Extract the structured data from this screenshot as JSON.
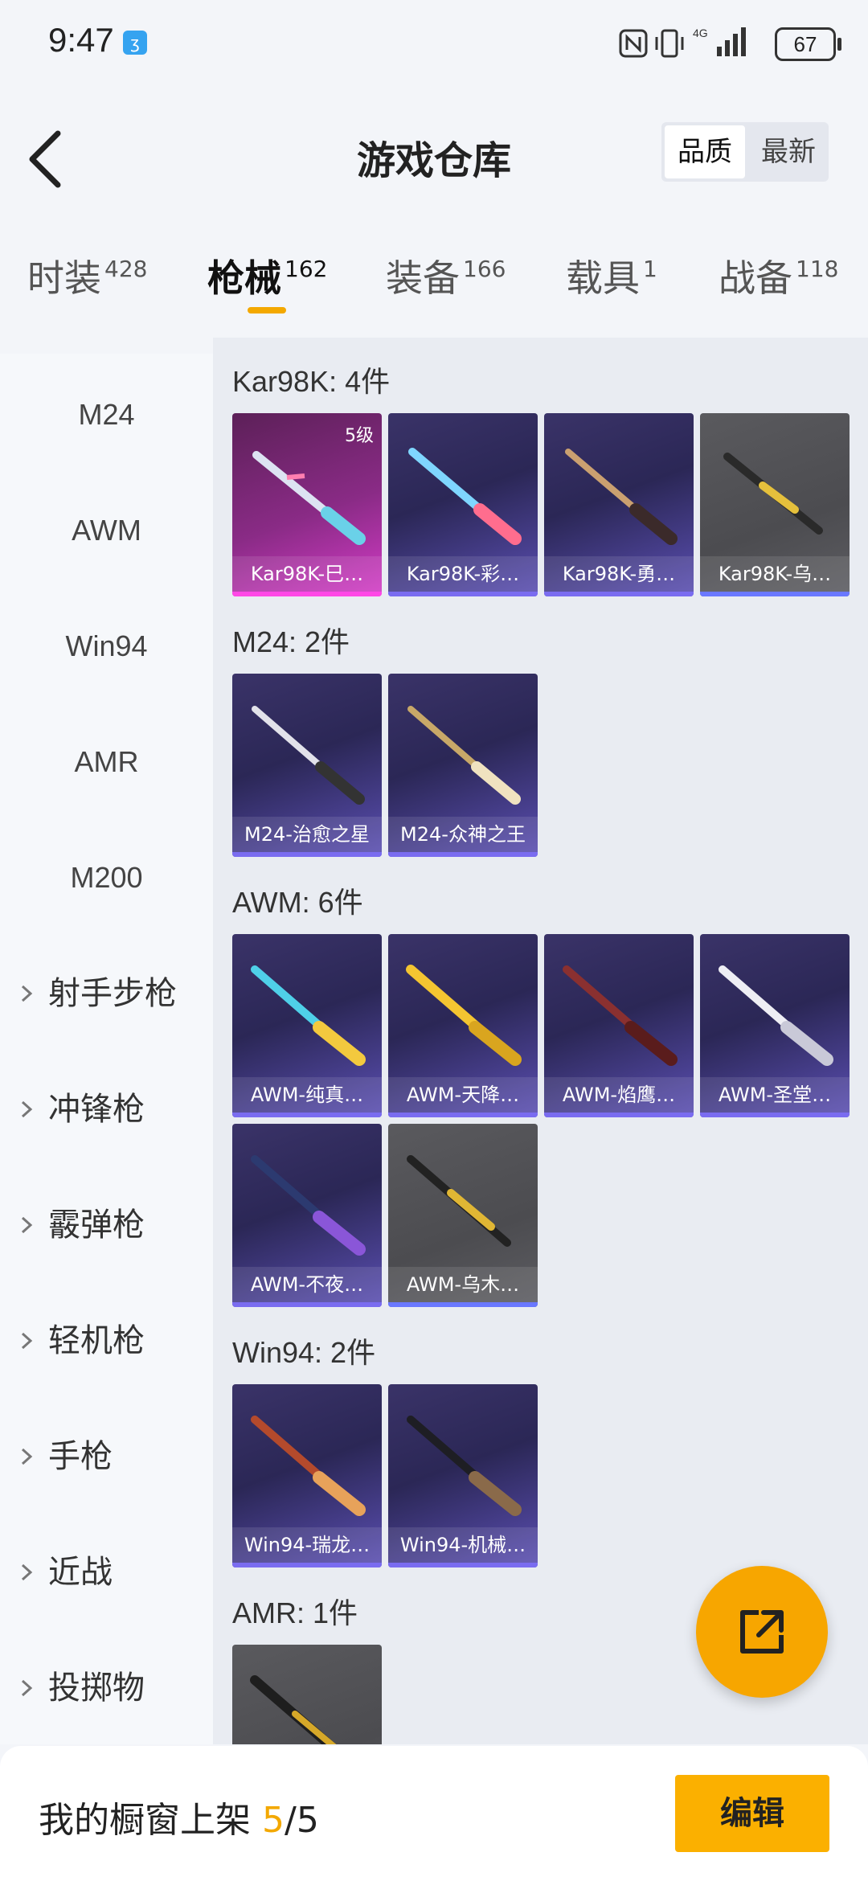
{
  "status": {
    "time": "9:47",
    "battery": "67",
    "network": "4G"
  },
  "header": {
    "title": "游戏仓库",
    "sort_options": [
      "品质",
      "最新"
    ],
    "selected_sort": "品质"
  },
  "tabs": [
    {
      "label": "时装",
      "count": "428"
    },
    {
      "label": "枪械",
      "count": "162"
    },
    {
      "label": "装备",
      "count": "166"
    },
    {
      "label": "载具",
      "count": "1"
    },
    {
      "label": "战备",
      "count": "118"
    }
  ],
  "active_tab": "枪械",
  "sidebar": {
    "items": [
      "M24",
      "AWM",
      "Win94",
      "AMR",
      "M200"
    ],
    "groups": [
      "射手步枪",
      "冲锋枪",
      "霰弹枪",
      "轻机枪",
      "手枪",
      "近战",
      "投掷物"
    ]
  },
  "sections": [
    {
      "title": "Kar98K: 4件",
      "cards": [
        {
          "name": "Kar98K-巳…",
          "level": "5级",
          "quality": "pink",
          "icon": "rifle-icon"
        },
        {
          "name": "Kar98K-彩…",
          "quality": "purple",
          "icon": "rifle-icon"
        },
        {
          "name": "Kar98K-勇…",
          "quality": "purple",
          "icon": "rifle-icon"
        },
        {
          "name": "Kar98K-乌…",
          "quality": "gray",
          "icon": "rifle-icon"
        }
      ]
    },
    {
      "title": "M24: 2件",
      "cards": [
        {
          "name": "M24-治愈之星",
          "quality": "purple",
          "icon": "rifle-icon"
        },
        {
          "name": "M24-众神之王",
          "quality": "purple",
          "icon": "rifle-icon"
        }
      ]
    },
    {
      "title": "AWM: 6件",
      "cards": [
        {
          "name": "AWM-纯真…",
          "quality": "purple",
          "icon": "rifle-icon"
        },
        {
          "name": "AWM-天降…",
          "quality": "purple",
          "icon": "rifle-icon"
        },
        {
          "name": "AWM-焰鹰…",
          "quality": "purple",
          "icon": "rifle-icon"
        },
        {
          "name": "AWM-圣堂…",
          "quality": "purple",
          "icon": "rifle-icon"
        },
        {
          "name": "AWM-不夜…",
          "quality": "purple",
          "icon": "rifle-icon"
        },
        {
          "name": "AWM-乌木…",
          "quality": "gray",
          "icon": "rifle-icon"
        }
      ]
    },
    {
      "title": "Win94: 2件",
      "cards": [
        {
          "name": "Win94-瑞龙…",
          "quality": "purple",
          "icon": "rifle-icon"
        },
        {
          "name": "Win94-机械…",
          "quality": "purple",
          "icon": "rifle-icon"
        }
      ]
    },
    {
      "title": "AMR: 1件",
      "cards": [
        {
          "name": "",
          "quality": "gray",
          "icon": "rifle-icon"
        }
      ]
    }
  ],
  "bottom": {
    "label": "我的橱窗上架 ",
    "current": "5",
    "total": "/5",
    "edit_label": "编辑"
  },
  "colors": {
    "accent": "#f3a800",
    "epic": "#7a6cf0",
    "legendary": "#ff48e6"
  }
}
